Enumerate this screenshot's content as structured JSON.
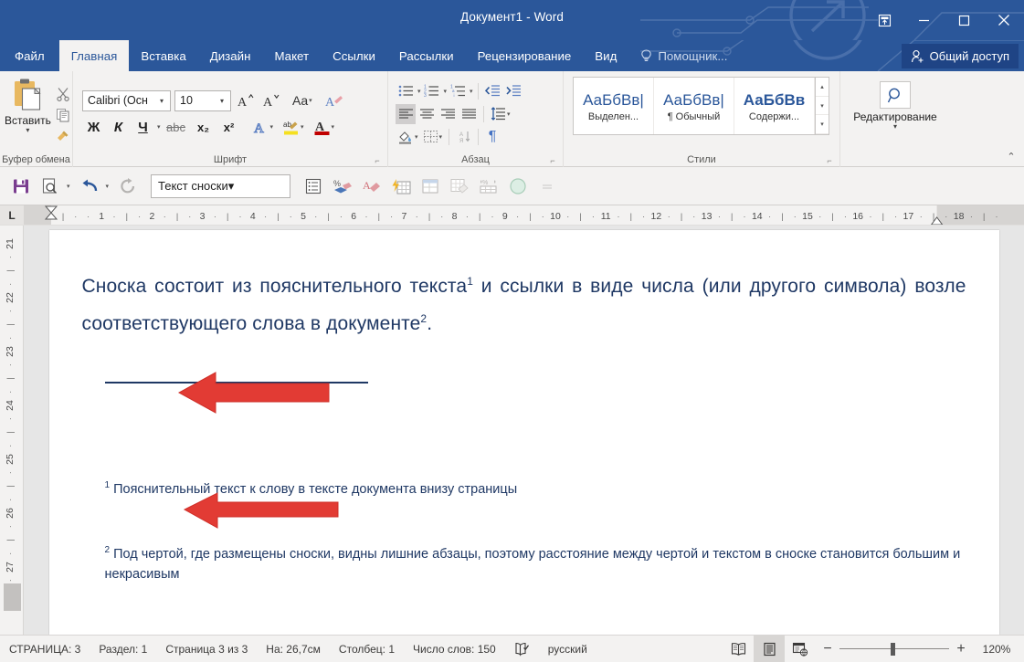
{
  "window": {
    "title": "Документ1 - Word",
    "buttons": {
      "ribbon_display": "ribbon-display-options-icon",
      "minimize": "minimize-icon",
      "maximize": "maximize-icon",
      "close": "close-icon"
    }
  },
  "tabs": [
    {
      "label": "Файл",
      "active": false
    },
    {
      "label": "Главная",
      "active": true
    },
    {
      "label": "Вставка",
      "active": false
    },
    {
      "label": "Дизайн",
      "active": false
    },
    {
      "label": "Макет",
      "active": false
    },
    {
      "label": "Ссылки",
      "active": false
    },
    {
      "label": "Рассылки",
      "active": false
    },
    {
      "label": "Рецензирование",
      "active": false
    },
    {
      "label": "Вид",
      "active": false
    }
  ],
  "assistant": {
    "label": "Помощник...",
    "icon": "lightbulb-icon"
  },
  "share": {
    "label": "Общий доступ",
    "icon": "person-add-icon"
  },
  "ribbon": {
    "groups": [
      {
        "name": "Буфер обмена",
        "label": "Буфер обмена"
      },
      {
        "name": "Шрифт",
        "label": "Шрифт"
      },
      {
        "name": "Абзац",
        "label": "Абзац"
      },
      {
        "name": "Стили",
        "label": "Стили"
      },
      {
        "name": "Редактирование",
        "label": "Редактирование"
      }
    ],
    "clipboard": {
      "paste_label": "Вставить",
      "cut": "scissors-icon",
      "copy": "copy-icon",
      "format_painter": "format-painter-icon"
    },
    "font": {
      "family": "Calibri (Осн",
      "size": "10",
      "bold": "Ж",
      "italic": "К",
      "underline": "Ч",
      "strikethrough": "abc",
      "subscript": "x₂",
      "superscript": "x²",
      "grow": "A",
      "shrink": "A",
      "change_case": "Aa",
      "clear_format": "clear-formatting-icon",
      "text_effects": "text-effects-icon",
      "highlight": "highlight-icon",
      "font_color": "font-color-icon"
    },
    "paragraph": {
      "bullets": "bullet-list-icon",
      "numbering": "numbered-list-icon",
      "multilevel": "multilevel-list-icon",
      "decrease_indent": "decrease-indent-icon",
      "increase_indent": "increase-indent-icon",
      "align_left": "align-left-icon",
      "align_center": "align-center-icon",
      "align_right": "align-right-icon",
      "justify": "justify-icon",
      "line_spacing": "line-spacing-icon",
      "shading": "shading-icon",
      "borders": "borders-icon",
      "sort": "sort-icon",
      "show_marks": "¶"
    },
    "styles": [
      {
        "sample": "АаБбВв|",
        "name": "Выделен...",
        "bold": false
      },
      {
        "sample": "АаБбВв|",
        "name": "¶ Обычный",
        "bold": false
      },
      {
        "sample": "АаБбВв",
        "name": "Содержи...",
        "bold": true
      }
    ],
    "editing": {
      "label": "Редактирование",
      "icon": "search-icon"
    },
    "collapse": "collapse-ribbon-icon"
  },
  "toolbar2": {
    "buttons": [
      {
        "name": "save-icon"
      },
      {
        "name": "print-preview-icon"
      },
      {
        "name": "undo-icon"
      },
      {
        "name": "redo-icon"
      }
    ],
    "style_combo": "Текст сноски",
    "right_buttons": [
      {
        "name": "list-properties-icon"
      },
      {
        "name": "percent-eraser-icon"
      },
      {
        "name": "letter-eraser-icon"
      },
      {
        "name": "table-flash-icon"
      },
      {
        "name": "table-props-icon"
      },
      {
        "name": "table-eraser-icon"
      },
      {
        "name": "table-percent-icon"
      },
      {
        "name": "circle-icon"
      },
      {
        "name": "more-icon"
      }
    ]
  },
  "ruler": {
    "tab_selector": "L",
    "horizontal_labels": [
      "1",
      "2",
      "3",
      "4",
      "5",
      "6",
      "7",
      "8",
      "9",
      "10",
      "11",
      "12",
      "13",
      "14",
      "15",
      "16",
      "17",
      "18"
    ],
    "vertical_labels": [
      "21",
      "22",
      "23",
      "24",
      "25",
      "26",
      "27"
    ]
  },
  "document": {
    "paragraph1_part1": "Сноска состоит из пояснительного текста",
    "paragraph1_sup1": "1",
    "paragraph1_part2": " и ссылки в виде числа (или другого символа) возле соответствующего слова в документе",
    "paragraph1_sup2": "2",
    "paragraph1_part3": ".",
    "footnote1_sup": "1",
    "footnote1_text": " Пояснительный текст к слову в тексте документа внизу страницы",
    "footnote2_sup": "2",
    "footnote2_text": " Под чертой, где размещены сноски, видны лишние абзацы, поэтому расстояние между чертой и текстом в сноске становится большим и некрасивым",
    "text_color": "#1f3864",
    "annotation_color": "#e23b34",
    "arrows": [
      {
        "name": "annotation-arrow-upper"
      },
      {
        "name": "annotation-arrow-lower"
      }
    ]
  },
  "statusbar": {
    "page_label": "СТРАНИЦА: 3",
    "section_label": "Раздел: 1",
    "page_of": "Страница 3 из 3",
    "position": "На: 26,7см",
    "column": "Столбец: 1",
    "words": "Число слов: 150",
    "proofing": "proofing-icon",
    "language": "русский",
    "views": [
      {
        "name": "read-mode-icon",
        "active": false
      },
      {
        "name": "print-layout-icon",
        "active": true
      },
      {
        "name": "web-layout-icon",
        "active": false
      }
    ],
    "zoom_out": "−",
    "zoom_in": "+",
    "zoom_level": "120%"
  }
}
